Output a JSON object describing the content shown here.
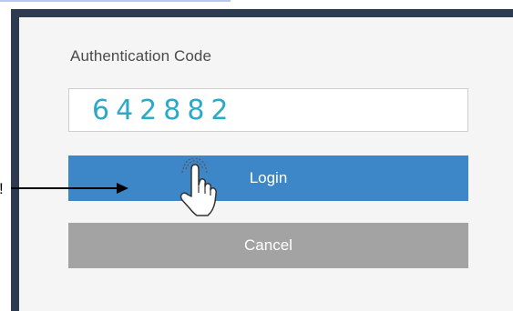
{
  "auth_form": {
    "code_label": "Authentication Code",
    "code_value": "642882",
    "login_label": "Login",
    "cancel_label": "Cancel"
  },
  "annotation": {
    "edge_glyph": "!",
    "arrow_icon": "right-arrow-icon",
    "hand_icon": "hand-pointer-icon",
    "arrow_color": "#000000"
  },
  "colors": {
    "frame": "#2e3a4f",
    "panel": "#f5f5f5",
    "login_button": "#3d87c8",
    "cancel_button": "#a3a3a3",
    "code_text": "#2aa9c9"
  }
}
